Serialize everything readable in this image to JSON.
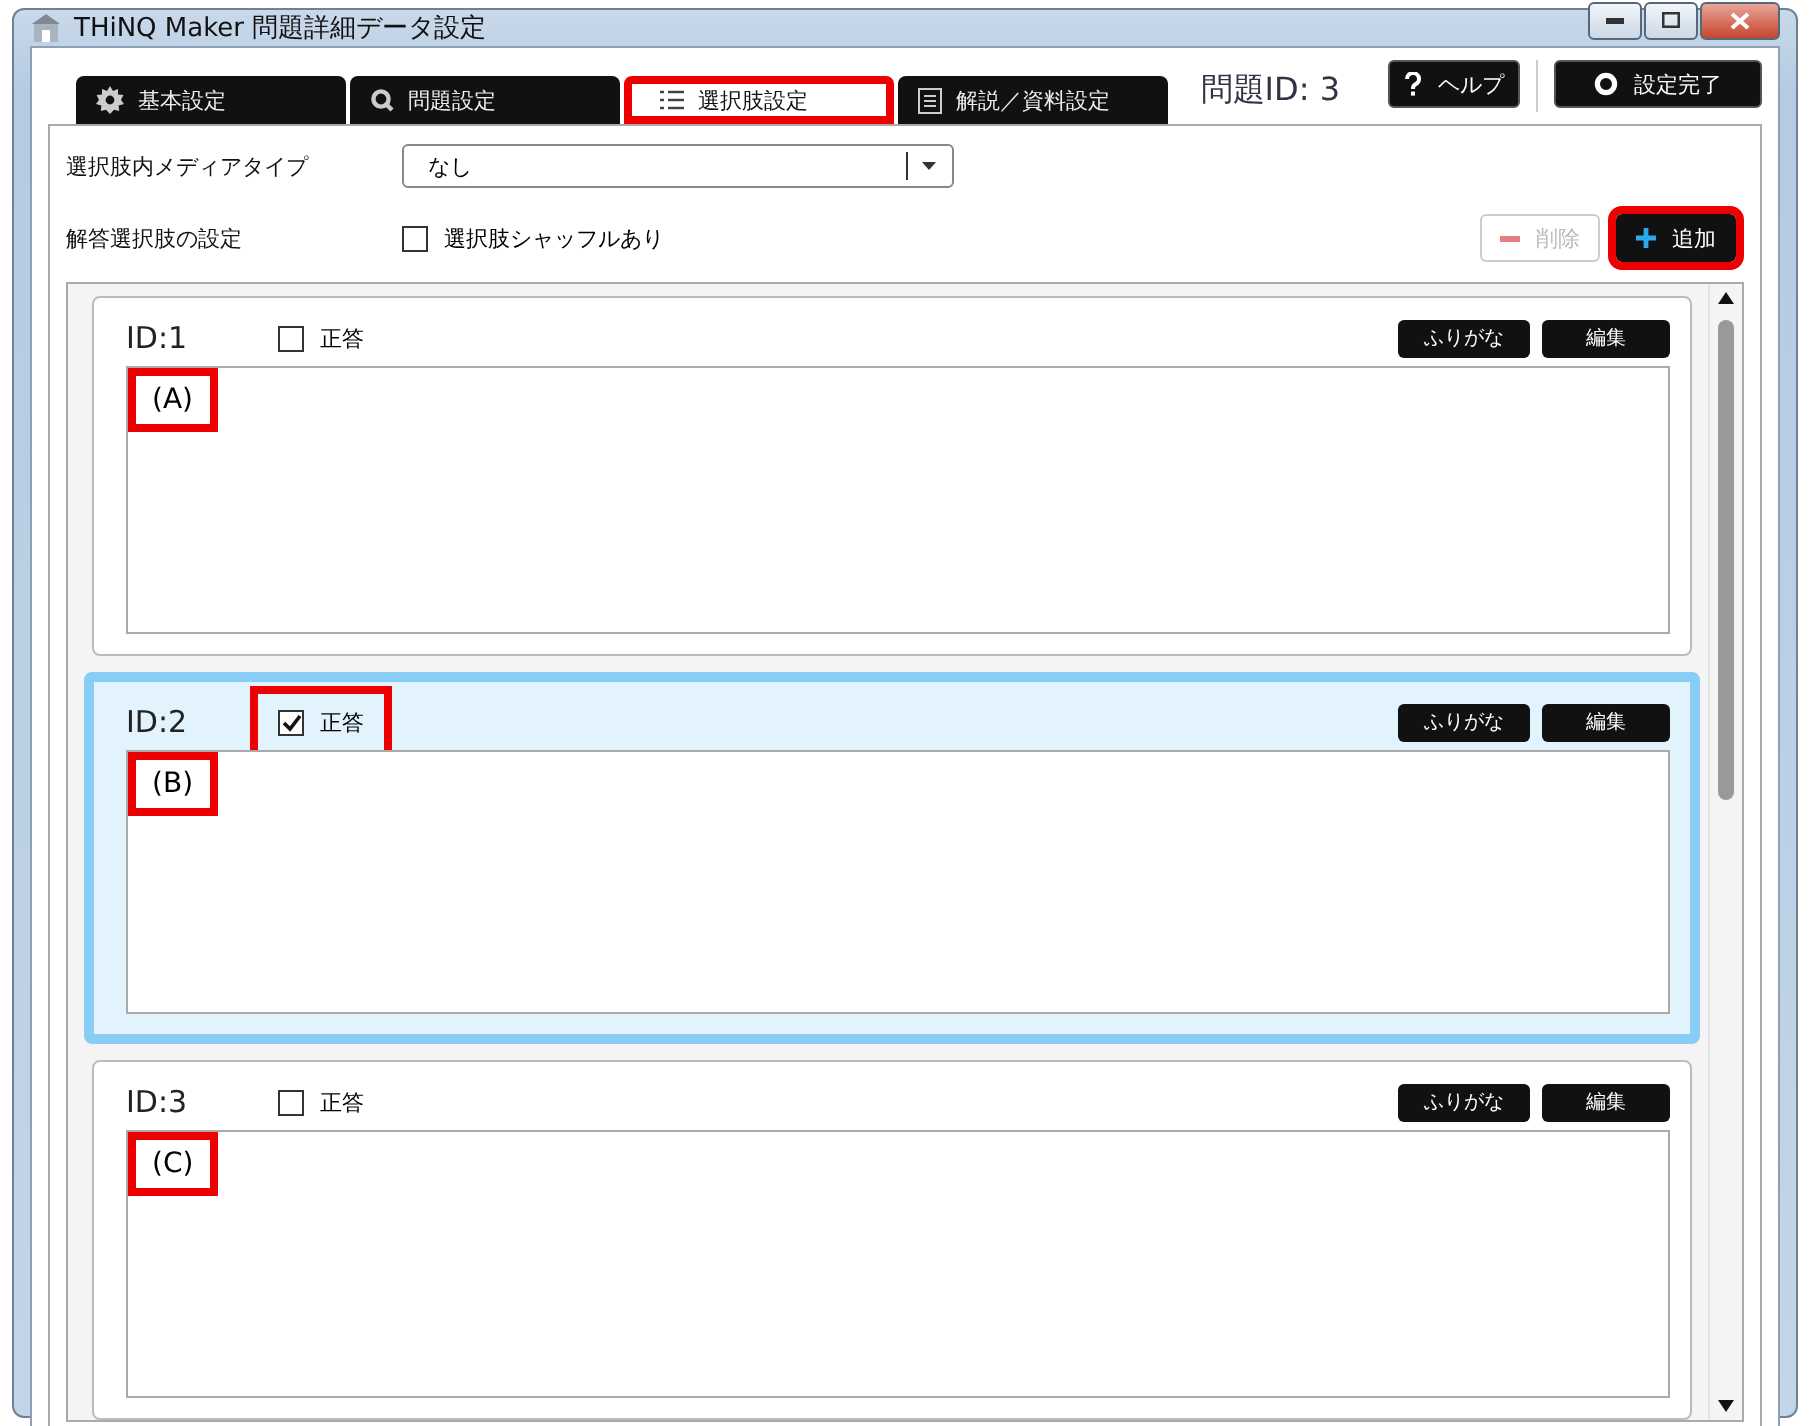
{
  "window": {
    "title": "THiNQ Maker 問題詳細データ設定"
  },
  "tabs": [
    {
      "label": "基本設定",
      "kind": "gear",
      "selected": false,
      "highlighted": false
    },
    {
      "label": "問題設定",
      "kind": "search",
      "selected": false,
      "highlighted": false
    },
    {
      "label": "選択肢設定",
      "kind": "list",
      "selected": true,
      "highlighted": true
    },
    {
      "label": "解説／資料設定",
      "kind": "doc",
      "selected": false,
      "highlighted": false
    }
  ],
  "question_id": "問題ID: 3",
  "header_buttons": [
    {
      "label": "ヘルプ",
      "kind": "help"
    },
    {
      "label": "設定完了",
      "kind": "done"
    }
  ],
  "media_type": {
    "label": "選択肢内メディアタイプ",
    "value": "なし"
  },
  "answer_settings": {
    "label": "解答選択肢の設定",
    "shuffle": {
      "label": "選択肢シャッフルあり",
      "checked": false
    }
  },
  "actions": [
    {
      "label": "削除",
      "kind": "remove",
      "disabled": true,
      "highlighted": false
    },
    {
      "label": "追加",
      "kind": "add",
      "disabled": false,
      "highlighted": true
    }
  ],
  "choices": [
    {
      "id": "ID:1",
      "correct_label": "正答",
      "correct": false,
      "selected": false,
      "correct_highlighted": false,
      "text": "(A)",
      "text_highlighted": true,
      "furigana": "ふりがな",
      "edit": "編集"
    },
    {
      "id": "ID:2",
      "correct_label": "正答",
      "correct": true,
      "selected": true,
      "correct_highlighted": true,
      "text": "(B)",
      "text_highlighted": true,
      "furigana": "ふりがな",
      "edit": "編集"
    },
    {
      "id": "ID:3",
      "correct_label": "正答",
      "correct": false,
      "selected": false,
      "correct_highlighted": false,
      "text": "(C)",
      "text_highlighted": true,
      "furigana": "ふりがな",
      "edit": "編集"
    }
  ]
}
